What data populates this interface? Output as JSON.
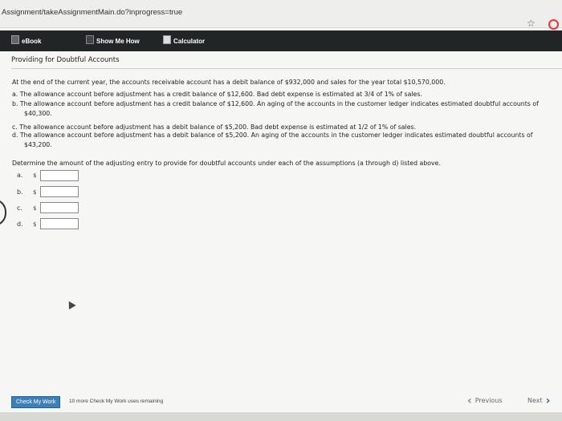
{
  "browser": {
    "url": "Assignment/takeAssignmentMain.do?inprogress=true",
    "star_icon": "star-icon",
    "opera_icon": "opera-icon"
  },
  "toolbar": {
    "ebook": "eBook",
    "show_me_how": "Show Me How",
    "calculator": "Calculator"
  },
  "problem": {
    "title": "Providing for Doubtful Accounts",
    "intro": "At the end of the current year, the accounts receivable account has a debit balance of $932,000 and sales for the year total $10,570,000.",
    "a": "a. The allowance account before adjustment has a credit balance of $12,600. Bad debt expense is estimated at 3/4 of 1% of sales.",
    "b1": "b. The allowance account before adjustment has a credit balance of $12,600. An aging of the accounts in the customer ledger indicates estimated doubtful accounts of",
    "b2": "$40,300.",
    "c": "c. The allowance account before adjustment has a debit balance of $5,200. Bad debt expense is estimated at 1/2 of 1% of sales.",
    "d1": "d. The allowance account before adjustment has a debit balance of $5,200. An aging of the accounts in the customer ledger indicates estimated doubtful accounts of",
    "d2": "$43,200.",
    "question": "Determine the amount of the adjusting entry to provide for doubtful accounts under each of the assumptions (a through d) listed above."
  },
  "answers": [
    {
      "label": "a.",
      "currency": "$",
      "value": ""
    },
    {
      "label": "b.",
      "currency": "$",
      "value": ""
    },
    {
      "label": "c.",
      "currency": "$",
      "value": ""
    },
    {
      "label": "d.",
      "currency": "$",
      "value": ""
    }
  ],
  "footer": {
    "check_button": "Check My Work",
    "remaining": "10 more Check My Work uses remaining",
    "previous": "Previous",
    "next": "Next"
  }
}
